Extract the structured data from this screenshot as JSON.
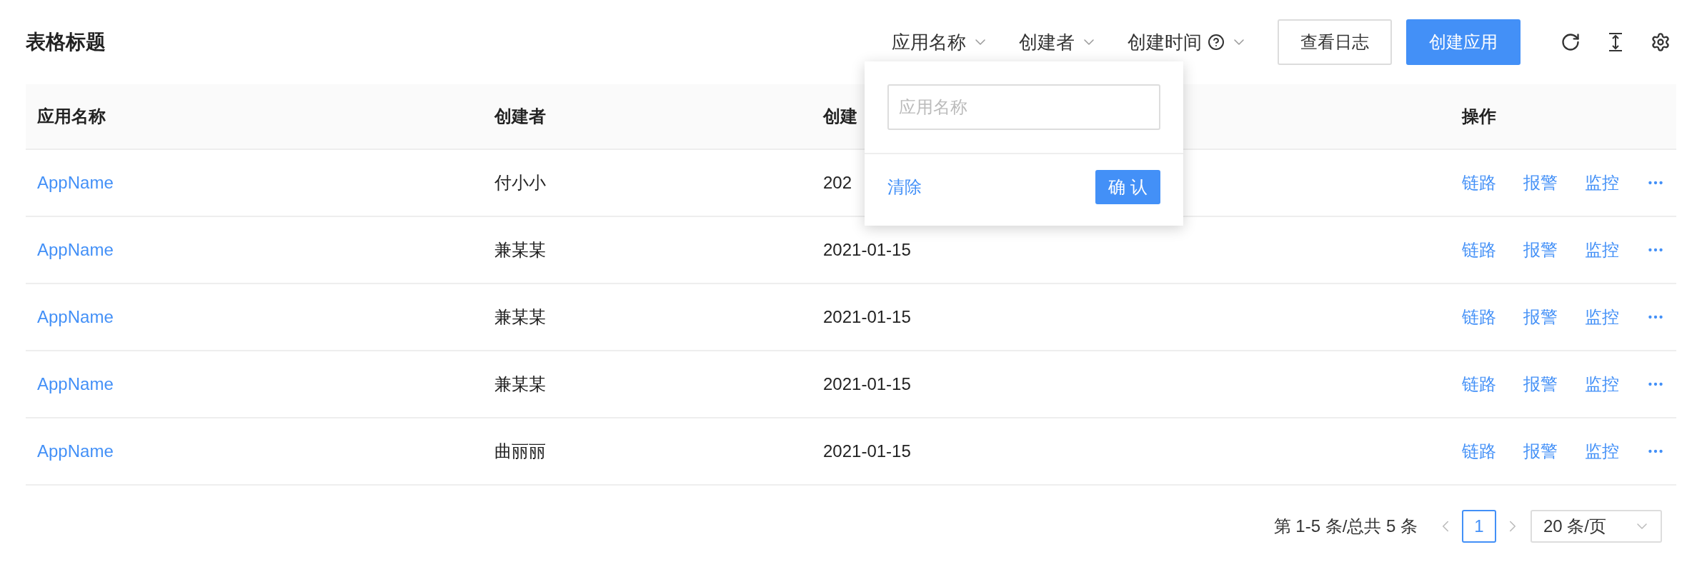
{
  "title": "表格标题",
  "filters": [
    {
      "label": "应用名称",
      "help": false
    },
    {
      "label": "创建者",
      "help": false
    },
    {
      "label": "创建时间",
      "help": true
    }
  ],
  "popover": {
    "placeholder": "应用名称",
    "clear": "清除",
    "confirm": "确 认"
  },
  "buttons": [
    {
      "label": "查看日志",
      "kind": "default"
    },
    {
      "label": "创建应用",
      "kind": "primary"
    }
  ],
  "table": {
    "columns": [
      "应用名称",
      "创建者",
      "创建",
      "操作"
    ],
    "rows": [
      {
        "name": "AppName",
        "creator": "付小小",
        "date": "202",
        "actions": [
          "链路",
          "报警",
          "监控"
        ]
      },
      {
        "name": "AppName",
        "creator": "兼某某",
        "date": "2021-01-15",
        "actions": [
          "链路",
          "报警",
          "监控"
        ]
      },
      {
        "name": "AppName",
        "creator": "兼某某",
        "date": "2021-01-15",
        "actions": [
          "链路",
          "报警",
          "监控"
        ]
      },
      {
        "name": "AppName",
        "creator": "兼某某",
        "date": "2021-01-15",
        "actions": [
          "链路",
          "报警",
          "监控"
        ]
      },
      {
        "name": "AppName",
        "creator": "曲丽丽",
        "date": "2021-01-15",
        "actions": [
          "链路",
          "报警",
          "监控"
        ]
      }
    ]
  },
  "pagination": {
    "summary": "第 1-5 条/总共 5 条",
    "pages": [
      {
        "label": "1",
        "selected": true
      }
    ],
    "page_size": "20 条/页"
  }
}
